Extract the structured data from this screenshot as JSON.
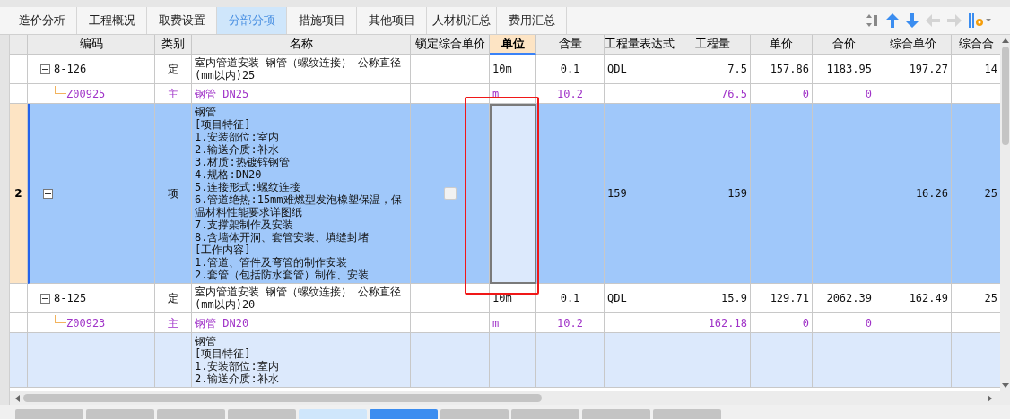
{
  "tabs": [
    {
      "label": "造价分析",
      "selected": false
    },
    {
      "label": "工程概况",
      "selected": false
    },
    {
      "label": "取费设置",
      "selected": false
    },
    {
      "label": "分部分项",
      "selected": true
    },
    {
      "label": "措施项目",
      "selected": false
    },
    {
      "label": "其他项目",
      "selected": false
    },
    {
      "label": "人材机汇总",
      "selected": false
    },
    {
      "label": "费用汇总",
      "selected": false
    }
  ],
  "toolbar": [
    {
      "kind": "sort",
      "disabled": false
    },
    {
      "kind": "up",
      "disabled": false
    },
    {
      "kind": "down",
      "disabled": false
    },
    {
      "kind": "left",
      "disabled": true
    },
    {
      "kind": "right",
      "disabled": true
    },
    {
      "kind": "settings",
      "disabled": false
    }
  ],
  "table": {
    "columns": [
      {
        "label": "编码",
        "selected": false
      },
      {
        "label": "类别",
        "selected": false
      },
      {
        "label": "名称",
        "selected": false
      },
      {
        "label": "锁定综合单价",
        "selected": false
      },
      {
        "label": "单位",
        "selected": true
      },
      {
        "label": "含量",
        "selected": false
      },
      {
        "label": "工程量表达式",
        "selected": false
      },
      {
        "label": "工程量",
        "selected": false
      },
      {
        "label": "单价",
        "selected": false
      },
      {
        "label": "合价",
        "selected": false
      },
      {
        "label": "综合单价",
        "selected": false
      },
      {
        "label": "综合合",
        "selected": false
      }
    ],
    "rows": [
      {
        "kind": "quota",
        "expanded": true,
        "selected": false,
        "cells": [
          "8-126",
          "定",
          "室内管道安装 钢管（螺纹连接） 公称直径(mm以内)25",
          "",
          "10m",
          "0.1",
          "QDL",
          "7.5",
          "157.86",
          "1183.95",
          "197.27",
          "14"
        ],
        "children": [
          {
            "kind": "material",
            "selected": false,
            "cells": [
              "Z00925",
              "主",
              "钢管 DN25",
              "",
              "m",
              "10.2",
              "",
              "76.5",
              "0",
              "0",
              "",
              ""
            ]
          }
        ]
      },
      {
        "kind": "item",
        "number": "2",
        "expanded": true,
        "selected": true,
        "locked": false,
        "active_unit": true,
        "cells": [
          "",
          "项",
          "钢管\n[项目特征]\n1.安装部位:室内\n2.输送介质:补水\n3.材质:热镀锌钢管\n4.规格:DN20\n5.连接形式:螺纹连接\n6.管道绝热:15mm难燃型发泡橡塑保温，保温材料性能要求详图纸\n7.支撑架制作及安装\n8.含墙体开洞、套管安装、填缝封堵\n[工作内容]\n1.管道、管件及弯管的制作安装\n2.套管（包括防水套管）制作、安装",
          "",
          "",
          "",
          "159",
          "159",
          "",
          "",
          "16.26",
          "25"
        ],
        "children": [
          {
            "kind": "quota",
            "expanded": true,
            "selected": false,
            "cells": [
              "8-125",
              "定",
              "室内管道安装 钢管（螺纹连接） 公称直径(mm以内)20",
              "",
              "10m",
              "0.1",
              "QDL",
              "15.9",
              "129.71",
              "2062.39",
              "162.49",
              "25"
            ],
            "children": [
              {
                "kind": "material",
                "selected": false,
                "cells": [
                  "Z00923",
                  "主",
                  "钢管 DN20",
                  "",
                  "m",
                  "10.2",
                  "",
                  "162.18",
                  "0",
                  "0",
                  "",
                  ""
                ]
              }
            ]
          }
        ]
      },
      {
        "kind": "item",
        "selected": false,
        "cells": [
          "",
          "",
          "钢管\n[项目特征]\n1.安装部位:室内\n2.输送介质:补水",
          "",
          "",
          "",
          "",
          "",
          "",
          "",
          "",
          ""
        ]
      }
    ]
  },
  "bottom_tabs": [
    {
      "selected": false,
      "highlighted": false
    },
    {
      "selected": false,
      "highlighted": false
    },
    {
      "selected": false,
      "highlighted": false
    },
    {
      "selected": false,
      "highlighted": false
    },
    {
      "selected": false,
      "highlighted": true
    },
    {
      "selected": true,
      "highlighted": false
    },
    {
      "selected": false,
      "highlighted": false
    },
    {
      "selected": false,
      "highlighted": false
    },
    {
      "selected": false,
      "highlighted": false
    },
    {
      "selected": false,
      "highlighted": false
    }
  ]
}
